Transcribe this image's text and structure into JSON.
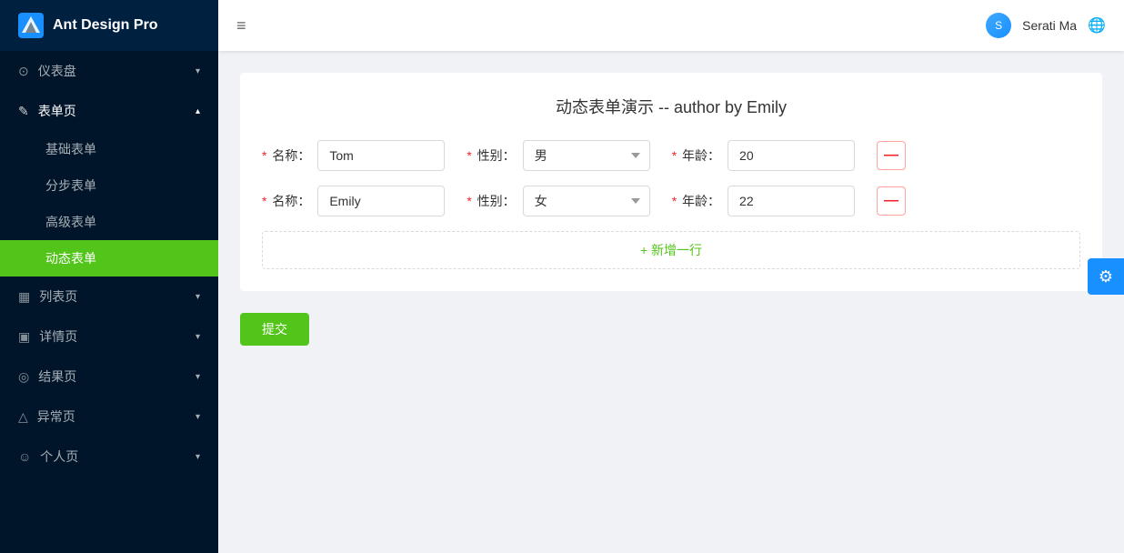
{
  "app": {
    "title": "Ant Design Pro",
    "logo_alt": "ant-design-pro-logo"
  },
  "header": {
    "menu_toggle_icon": "≡",
    "user": {
      "name": "Serati Ma",
      "avatar_initials": "S"
    },
    "globe_icon": "🌐"
  },
  "sidebar": {
    "items": [
      {
        "id": "dashboard",
        "label": "仪表盘",
        "icon": "⊙",
        "has_children": true,
        "expanded": false
      },
      {
        "id": "forms",
        "label": "表单页",
        "icon": "✎",
        "has_children": true,
        "expanded": true
      },
      {
        "id": "list",
        "label": "列表页",
        "icon": "▦",
        "has_children": true,
        "expanded": false
      },
      {
        "id": "detail",
        "label": "详情页",
        "icon": "▣",
        "has_children": true,
        "expanded": false
      },
      {
        "id": "result",
        "label": "结果页",
        "icon": "◎",
        "has_children": true,
        "expanded": false
      },
      {
        "id": "exception",
        "label": "异常页",
        "icon": "△",
        "has_children": true,
        "expanded": false
      },
      {
        "id": "profile",
        "label": "个人页",
        "icon": "☺",
        "has_children": true,
        "expanded": false
      }
    ],
    "sub_items": [
      {
        "id": "basic-form",
        "label": "基础表单"
      },
      {
        "id": "step-form",
        "label": "分步表单"
      },
      {
        "id": "advanced-form",
        "label": "高级表单"
      },
      {
        "id": "dynamic-form",
        "label": "动态表单",
        "active": true
      }
    ]
  },
  "page": {
    "title": "动态表单演示 -- author by Emily",
    "rows": [
      {
        "name_label": "名称",
        "name_value": "Tom",
        "gender_label": "性别",
        "gender_value": "男",
        "age_label": "年龄",
        "age_value": "20"
      },
      {
        "name_label": "名称",
        "name_value": "Emily",
        "gender_label": "性别",
        "gender_value": "女",
        "age_label": "年龄",
        "age_value": "22"
      }
    ],
    "add_row_label": "+ 新增一行",
    "submit_label": "提交",
    "gender_options": [
      "男",
      "女"
    ],
    "required_star": "*"
  }
}
